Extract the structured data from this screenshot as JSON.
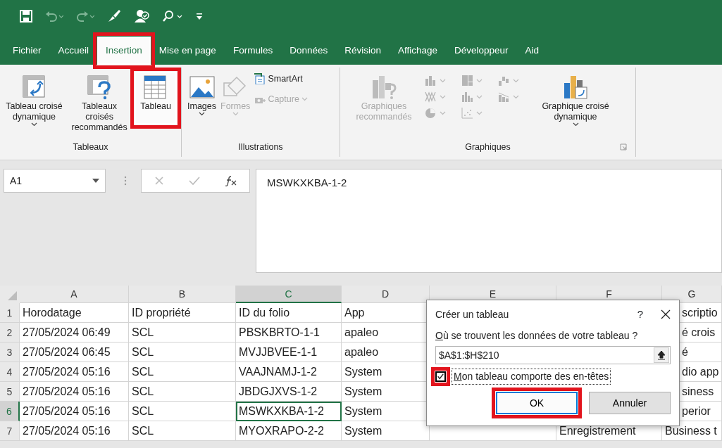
{
  "tabs": [
    {
      "label": "Fichier",
      "selected": false,
      "highlighted": false
    },
    {
      "label": "Accueil",
      "selected": false,
      "highlighted": false
    },
    {
      "label": "Insertion",
      "selected": true,
      "highlighted": true
    },
    {
      "label": "Mise en page",
      "selected": false,
      "highlighted": false
    },
    {
      "label": "Formules",
      "selected": false,
      "highlighted": false
    },
    {
      "label": "Données",
      "selected": false,
      "highlighted": false
    },
    {
      "label": "Révision",
      "selected": false,
      "highlighted": false
    },
    {
      "label": "Affichage",
      "selected": false,
      "highlighted": false
    },
    {
      "label": "Développeur",
      "selected": false,
      "highlighted": false
    },
    {
      "label": "Aid",
      "selected": false,
      "highlighted": false
    }
  ],
  "ribbon": {
    "groups": [
      {
        "label": "Tableaux",
        "launcher": false,
        "commands": [
          {
            "kind": "large",
            "label": "Tableau croisé dynamique",
            "dropdown": true,
            "disabled": false,
            "highlighted": false
          },
          {
            "kind": "large",
            "label": "Tableaux croisés recommandés",
            "dropdown": false,
            "disabled": false,
            "highlighted": false
          },
          {
            "kind": "large",
            "label": "Tableau",
            "dropdown": false,
            "disabled": false,
            "highlighted": true
          }
        ]
      },
      {
        "label": "Illustrations",
        "launcher": false,
        "commands": [
          {
            "kind": "large",
            "label": "Images",
            "dropdown": true,
            "disabled": false,
            "highlighted": false
          },
          {
            "kind": "large",
            "label": "Formes",
            "dropdown": true,
            "disabled": true,
            "highlighted": false
          },
          {
            "kind": "small",
            "label": "SmartArt",
            "dropdown": false,
            "disabled": false,
            "highlighted": false
          },
          {
            "kind": "small",
            "label": "Capture",
            "dropdown": true,
            "disabled": true,
            "highlighted": false
          }
        ]
      },
      {
        "label": "Graphiques",
        "launcher": true,
        "commands": [
          {
            "kind": "large",
            "label": "Graphiques recommandés",
            "dropdown": false,
            "disabled": true,
            "highlighted": false
          },
          {
            "kind": "gallery",
            "disabled": true
          },
          {
            "kind": "large",
            "label": "Graphique croisé dynamique",
            "dropdown": true,
            "disabled": false,
            "highlighted": false
          }
        ]
      }
    ]
  },
  "formula_bar": {
    "name_box": "A1",
    "formula": "MSWKXKBA-1-2"
  },
  "sheet": {
    "columns": [
      {
        "label": "A",
        "selected": false
      },
      {
        "label": "B",
        "selected": false
      },
      {
        "label": "C",
        "selected": true
      },
      {
        "label": "D",
        "selected": false
      },
      {
        "label": "E",
        "selected": false
      },
      {
        "label": "F",
        "selected": false
      },
      {
        "label": "G",
        "selected": false
      }
    ],
    "rows": [
      {
        "number": "1",
        "selected": false,
        "cells": [
          "Horodatage",
          "ID propriété",
          "ID du folio",
          "App",
          "",
          "",
          "scriptio"
        ]
      },
      {
        "number": "2",
        "selected": false,
        "cells": [
          "27/05/2024 06:49",
          "SCL",
          "PBSKBRTO-1-1",
          "apaleo",
          "",
          "",
          "é crois"
        ]
      },
      {
        "number": "3",
        "selected": false,
        "cells": [
          "27/05/2024 06:45",
          "SCL",
          "MVJJBVEE-1-1",
          "apaleo",
          "",
          "",
          "é"
        ]
      },
      {
        "number": "4",
        "selected": false,
        "cells": [
          "27/05/2024 05:16",
          "SCL",
          "VAAJNAMJ-1-2",
          "System",
          "",
          "",
          "dio app"
        ]
      },
      {
        "number": "5",
        "selected": false,
        "cells": [
          "27/05/2024 05:16",
          "SCL",
          "JBDGJXVS-1-2",
          "System",
          "",
          "",
          "siness"
        ]
      },
      {
        "number": "6",
        "selected": true,
        "cells": [
          "27/05/2024 05:16",
          "SCL",
          "MSWKXKBA-1-2",
          "System",
          "",
          "",
          "perior"
        ]
      },
      {
        "number": "7",
        "selected": false,
        "cells": [
          "27/05/2024 05:16",
          "SCL",
          "MYOXRAPO-2-2",
          "System",
          "",
          "Enregistrement",
          "Business t"
        ]
      }
    ]
  },
  "dialog": {
    "title": "Créer un tableau",
    "help": "?",
    "prompt": "Où se trouvent les données de votre tableau ?",
    "range": "$A$1:$H$210",
    "header_checkbox": {
      "label": "Mon tableau comporte des en-têtes",
      "checked": true,
      "highlighted": true
    },
    "buttons": [
      {
        "label": "OK",
        "default": true,
        "highlighted": true
      },
      {
        "label": "Annuler",
        "default": false,
        "highlighted": false
      }
    ]
  }
}
